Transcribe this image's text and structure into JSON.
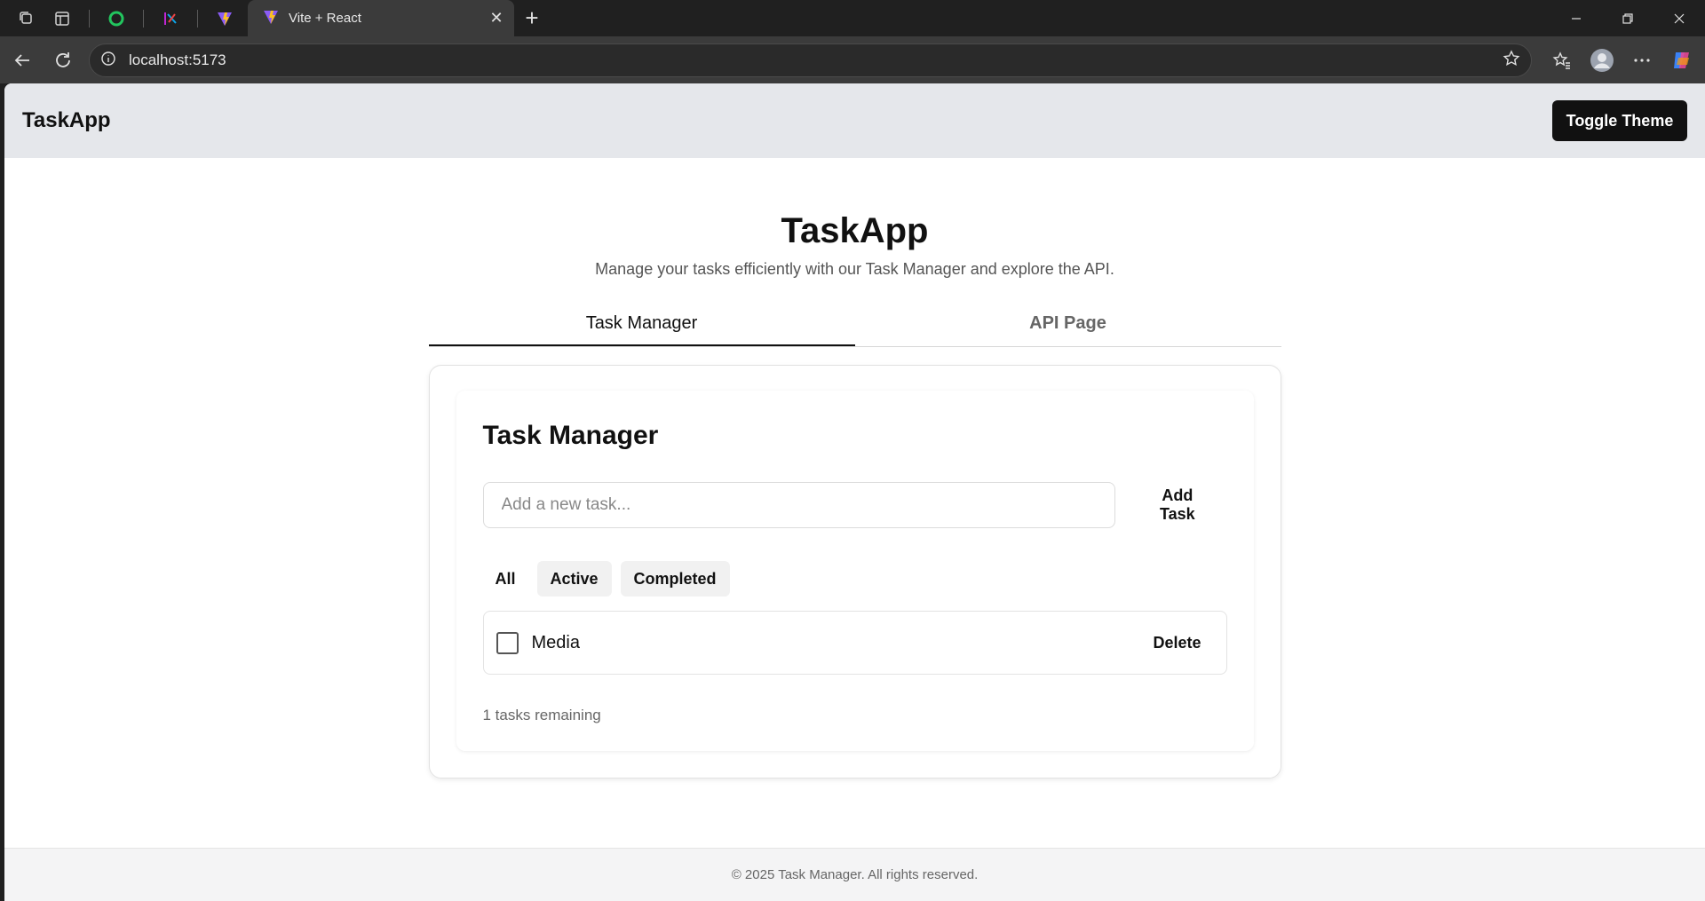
{
  "browser": {
    "active_tab_title": "Vite + React",
    "url": "localhost:5173"
  },
  "header": {
    "brand": "TaskApp",
    "toggle_label": "Toggle Theme"
  },
  "hero": {
    "title": "TaskApp",
    "subtitle": "Manage your tasks efficiently with our Task Manager and explore the API."
  },
  "tabs": [
    {
      "label": "Task Manager",
      "active": true
    },
    {
      "label": "API Page",
      "active": false
    }
  ],
  "task_manager": {
    "title": "Task Manager",
    "input_placeholder": "Add a new task...",
    "add_label": "Add Task",
    "filters": [
      {
        "label": "All",
        "selected": true
      },
      {
        "label": "Active",
        "selected": false
      },
      {
        "label": "Completed",
        "selected": false
      }
    ],
    "tasks": [
      {
        "text": "Media",
        "completed": false,
        "delete_label": "Delete"
      }
    ],
    "remaining_text": "1 tasks remaining"
  },
  "footer": {
    "text": "© 2025 Task Manager. All rights reserved."
  },
  "colors": {
    "header_bg": "#e5e7eb",
    "button_bg": "#111111",
    "browser_chrome": "#202020"
  }
}
